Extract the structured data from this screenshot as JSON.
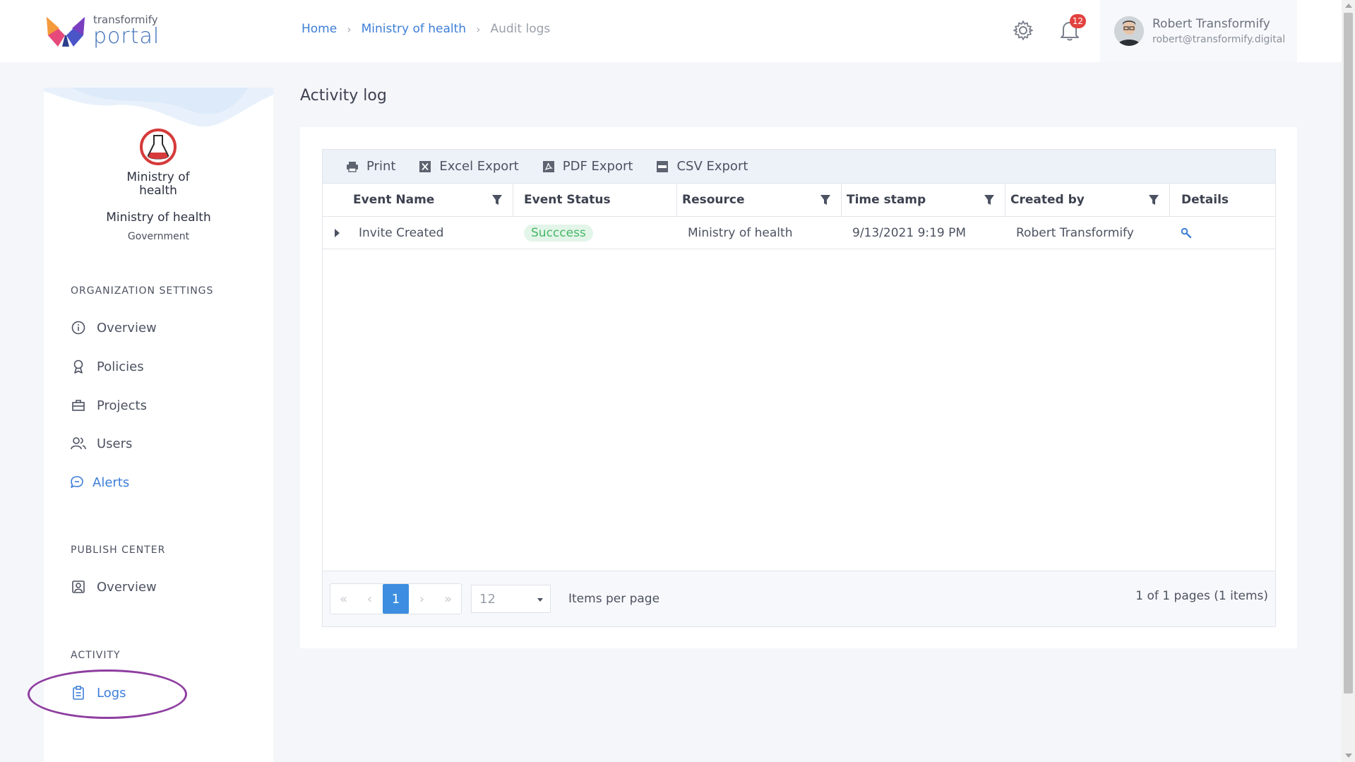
{
  "brand": {
    "small": "transformify",
    "big": "portal"
  },
  "breadcrumb": {
    "home": "Home",
    "org": "Ministry of health",
    "current": "Audit logs"
  },
  "notifications": {
    "count": "12"
  },
  "user": {
    "name": "Robert Transformify",
    "email": "robert@transformify.digital"
  },
  "organization": {
    "logo_line1": "Ministry of",
    "logo_line2": "health",
    "name": "Ministry of health",
    "type": "Government"
  },
  "sidebar": {
    "org_settings_title": "ORGANIZATION SETTINGS",
    "org_items": [
      {
        "label": "Overview",
        "icon": "info-icon"
      },
      {
        "label": "Policies",
        "icon": "policy-icon"
      },
      {
        "label": "Projects",
        "icon": "briefcase-icon"
      },
      {
        "label": "Users",
        "icon": "users-icon"
      },
      {
        "label": "Alerts",
        "icon": "chat-icon"
      }
    ],
    "publish_title": "PUBLISH CENTER",
    "publish_items": [
      {
        "label": "Overview",
        "icon": "profile-card-icon"
      }
    ],
    "activity_title": "ACTIVITY",
    "activity_items": [
      {
        "label": "Logs",
        "icon": "clipboard-icon"
      }
    ]
  },
  "page": {
    "title": "Activity log"
  },
  "toolbar": {
    "print": "Print",
    "excel": "Excel Export",
    "pdf": "PDF Export",
    "csv": "CSV Export"
  },
  "columns": [
    "Event Name",
    "Event Status",
    "Resource",
    "Time stamp",
    "Created by",
    "Details"
  ],
  "rows": [
    {
      "event_name": "Invite Created",
      "status": "Succcess",
      "resource": "Ministry of health",
      "timestamp": "9/13/2021 9:19 PM",
      "created_by": "Robert Transformify"
    }
  ],
  "pager": {
    "current_page": "1",
    "page_size": "12",
    "items_per_page_label": "Items per page",
    "info": "1 of 1 pages (1 items)"
  },
  "colors": {
    "accent": "#3d7ed8",
    "success_bg": "#e3f5e9",
    "success_text": "#46b765",
    "badge": "#e2423f",
    "annotation": "#8e3ea0"
  }
}
